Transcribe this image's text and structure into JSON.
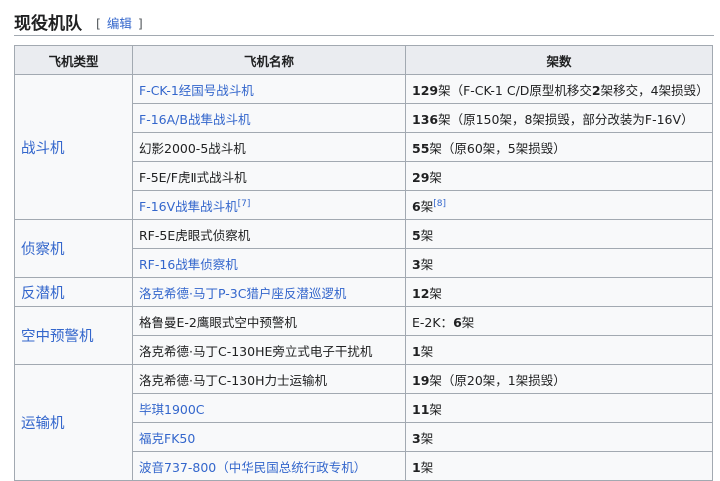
{
  "heading": {
    "title": "现役机队",
    "edit_open": "[",
    "edit_label": "编辑",
    "edit_close": "]"
  },
  "table": {
    "headers": [
      "飞机类型",
      "飞机名称",
      "架数"
    ],
    "groups": [
      {
        "type": "战斗机",
        "rows": [
          {
            "name": "F-CK-1经国号战斗机",
            "link": true,
            "cite": "",
            "count_prefix": "",
            "count_num": "129",
            "count_suffix": "架（F-CK-1 C/D原型机移交",
            "count_num2": "2",
            "count_suffix2": "架移交，4架损毁）",
            "count_cite": ""
          },
          {
            "name": "F-16A/B战隼战斗机",
            "link": true,
            "cite": "",
            "count_prefix": "",
            "count_num": "136",
            "count_suffix": "架（原150架，8架损毁，部分改装为F-16V）",
            "count_num2": "",
            "count_suffix2": "",
            "count_cite": ""
          },
          {
            "name": "幻影2000-5战斗机",
            "link": false,
            "cite": "",
            "count_prefix": "",
            "count_num": "55",
            "count_suffix": "架（原60架，5架损毁）",
            "count_num2": "",
            "count_suffix2": "",
            "count_cite": ""
          },
          {
            "name": "F-5E/F虎Ⅱ式战斗机",
            "link": false,
            "cite": "",
            "count_prefix": "",
            "count_num": "29",
            "count_suffix": "架",
            "count_num2": "",
            "count_suffix2": "",
            "count_cite": ""
          },
          {
            "name": "F-16V战隼战斗机",
            "link": true,
            "cite": "[7]",
            "count_prefix": "",
            "count_num": "6",
            "count_suffix": "架",
            "count_num2": "",
            "count_suffix2": "",
            "count_cite": "[8]"
          }
        ]
      },
      {
        "type": "侦察机",
        "rows": [
          {
            "name": "RF-5E虎眼式侦察机",
            "link": false,
            "cite": "",
            "count_prefix": "",
            "count_num": "5",
            "count_suffix": "架",
            "count_num2": "",
            "count_suffix2": "",
            "count_cite": ""
          },
          {
            "name": "RF-16战隼侦察机",
            "link": true,
            "cite": "",
            "count_prefix": "",
            "count_num": "3",
            "count_suffix": "架",
            "count_num2": "",
            "count_suffix2": "",
            "count_cite": ""
          }
        ]
      },
      {
        "type": "反潜机",
        "rows": [
          {
            "name": "洛克希德·马丁P-3C猎户座反潜巡逻机",
            "link": true,
            "cite": "",
            "count_prefix": "",
            "count_num": "12",
            "count_suffix": "架",
            "count_num2": "",
            "count_suffix2": "",
            "count_cite": ""
          }
        ]
      },
      {
        "type": "空中预警机",
        "rows": [
          {
            "name": "格鲁曼E-2鹰眼式空中预警机",
            "link": false,
            "cite": "",
            "count_prefix": "E-2K：",
            "count_num": "6",
            "count_suffix": "架",
            "count_num2": "",
            "count_suffix2": "",
            "count_cite": ""
          },
          {
            "name": "洛克希德·马丁C-130HE旁立式电子干扰机",
            "link": false,
            "cite": "",
            "count_prefix": "",
            "count_num": "1",
            "count_suffix": "架",
            "count_num2": "",
            "count_suffix2": "",
            "count_cite": ""
          }
        ]
      },
      {
        "type": "运输机",
        "rows": [
          {
            "name": "洛克希德·马丁C-130H力士运输机",
            "link": false,
            "cite": "",
            "count_prefix": "",
            "count_num": "19",
            "count_suffix": "架（原20架，1架损毁）",
            "count_num2": "",
            "count_suffix2": "",
            "count_cite": ""
          },
          {
            "name": "毕琪1900C",
            "link": true,
            "cite": "",
            "count_prefix": "",
            "count_num": "11",
            "count_suffix": "架",
            "count_num2": "",
            "count_suffix2": "",
            "count_cite": ""
          },
          {
            "name": "福克FK50",
            "link": true,
            "cite": "",
            "count_prefix": "",
            "count_num": "3",
            "count_suffix": "架",
            "count_num2": "",
            "count_suffix2": "",
            "count_cite": ""
          },
          {
            "name": "波音737-800（中华民国总统行政专机）",
            "link": true,
            "cite": "",
            "count_prefix": "",
            "count_num": "1",
            "count_suffix": "架",
            "count_num2": "",
            "count_suffix2": "",
            "count_cite": ""
          }
        ]
      }
    ]
  }
}
